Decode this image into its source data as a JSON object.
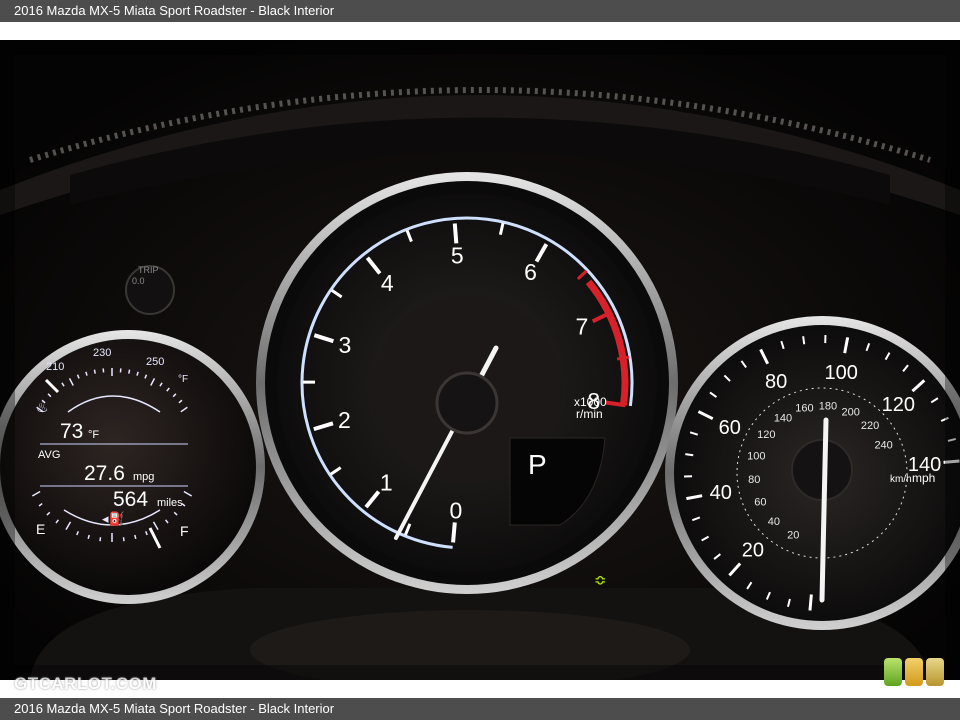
{
  "caption": {
    "title": "2016 Mazda MX-5 Miata Sport Roadster - Black Interior"
  },
  "watermark": {
    "text": "GTCARLOT.COM"
  },
  "cluster": {
    "trip_button": {
      "label_top": "TRIP",
      "label_bottom": "0.0"
    },
    "tachometer": {
      "labels": [
        "0",
        "1",
        "2",
        "3",
        "4",
        "5",
        "6",
        "7",
        "8"
      ],
      "unit_top": "x1000",
      "unit_bottom": "r/min",
      "gear": "P"
    },
    "speedometer": {
      "mph_labels": [
        "20",
        "40",
        "60",
        "80",
        "100",
        "120",
        "140"
      ],
      "kmh_labels": [
        "20",
        "40",
        "60",
        "80",
        "100",
        "120",
        "140",
        "160",
        "180",
        "200",
        "220",
        "240"
      ],
      "unit_mph": "mph",
      "unit_kmh": "km/h"
    },
    "info_display": {
      "temp_gauge_labels": [
        "210",
        "230",
        "250"
      ],
      "temp_unit": "°F",
      "outside_temp": "73",
      "outside_temp_unit": "°F",
      "avg_label": "AVG",
      "fuel_economy": "27.6",
      "fuel_economy_unit": "mpg",
      "range": "564",
      "range_unit": "miles",
      "fuel_empty": "E",
      "fuel_full": "F"
    }
  },
  "colors": {
    "tach_ring": "#cfe0ff",
    "redline": "#d8202a",
    "indicator_green": "#b6e800",
    "bezel": "#c9c9c9"
  }
}
